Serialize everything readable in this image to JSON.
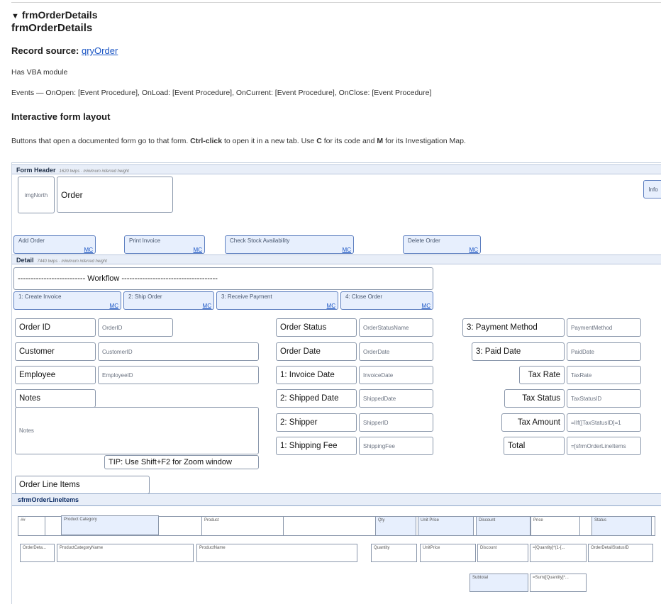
{
  "page": {
    "summary": "frmOrderDetails",
    "title": "frmOrderDetails",
    "record_source_label": "Record source:",
    "record_source_link": "qryOrder",
    "vba": "Has VBA module",
    "events": "Events — OnOpen: [Event Procedure], OnLoad: [Event Procedure], OnCurrent: [Event Procedure], OnClose: [Event Procedure]",
    "layout_heading": "Interactive form layout",
    "help": {
      "part1": "Buttons that open a documented form go to that form. ",
      "ctrl": "Ctrl-click",
      "part2": " to open it in a new tab. Use ",
      "c": "C",
      "part3": " for its code and ",
      "m": "M",
      "part4": " for its Investigation Map."
    }
  },
  "form": {
    "header": {
      "title": "Form Header",
      "note": "1620 twips · minimum inferred height"
    },
    "detail": {
      "title": "Detail",
      "note": "7440 twips · minimum inferred height"
    },
    "mc": "MC",
    "img_north": "imgNorth",
    "order_label": "Order",
    "info_button": "Info",
    "header_buttons": [
      "Add Order",
      "Print Invoice",
      "Check Stock Availability",
      "Delete Order"
    ],
    "workflow_label": "-------------------------- Workflow -------------------------------------",
    "workflow_buttons": [
      "1: Create Invoice",
      "2: Ship Order",
      "3: Receive Payment",
      "4: Close Order"
    ],
    "fields": {
      "order_id": {
        "label": "Order ID",
        "value": "OrderID"
      },
      "customer": {
        "label": "Customer",
        "value": "CustomerID"
      },
      "employee": {
        "label": "Employee",
        "value": "EmployeeID"
      },
      "notes_label": "Notes",
      "notes_value": "Notes",
      "order_status": {
        "label": "Order Status",
        "value": "OrderStatusName"
      },
      "order_date": {
        "label": "Order Date",
        "value": "OrderDate"
      },
      "invoice_date": {
        "label": "1: Invoice Date",
        "value": "InvoiceDate"
      },
      "shipped_date": {
        "label": "2: Shipped Date",
        "value": "ShippedDate"
      },
      "shipper": {
        "label": "2: Shipper",
        "value": "ShipperID"
      },
      "shipping_fee": {
        "label": "1: Shipping Fee",
        "value": "ShippingFee"
      },
      "payment_method": {
        "label": "3: Payment Method",
        "value": "PaymentMethod"
      },
      "paid_date": {
        "label": "3: Paid Date",
        "value": "PaidDate"
      },
      "tax_rate": {
        "label": "Tax Rate",
        "value": "TaxRate"
      },
      "tax_status": {
        "label": "Tax Status",
        "value": "TaxStatusID"
      },
      "tax_amount": {
        "label": "Tax Amount",
        "value": "=IIf([TaxStatusID]=1"
      },
      "total": {
        "label": "Total",
        "value": "=[sfrmOrderLineItems"
      }
    },
    "tip": "TIP: Use Shift+F2 for Zoom window",
    "order_line_items": "Order Line Items",
    "subform": {
      "name": "sfrmOrderLineItems",
      "headers": [
        "##",
        "Product Category",
        "Product",
        "Qty",
        "Unit Price",
        "Discount",
        "Price",
        "Status"
      ],
      "fields": [
        "OrderDeta...",
        "ProductCategoryName",
        "ProductName",
        "Quantity",
        "UnitPrice",
        "Discount",
        "=[Quantity]*(1-[...",
        "OrderDetailStatusID"
      ],
      "subtotal_label": "Subtotal",
      "subtotal_value": "=Sum([Quantity]*..."
    }
  }
}
